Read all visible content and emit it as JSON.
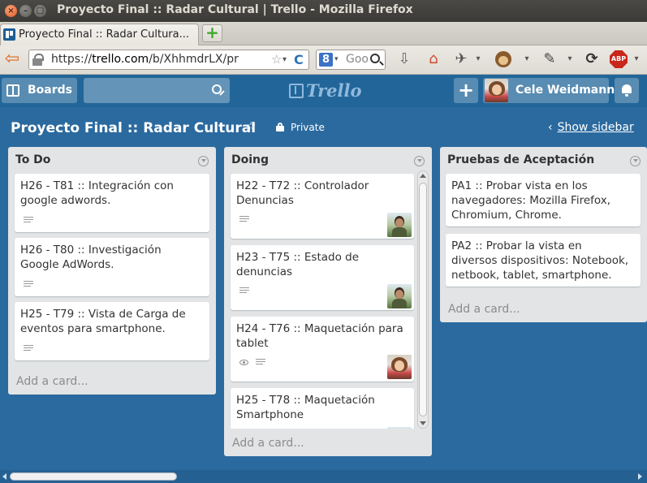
{
  "window": {
    "title": "Proyecto Final :: Radar Cultural | Trello - Mozilla Firefox",
    "close_glyph": "×",
    "min_glyph": "–",
    "max_glyph": "□"
  },
  "browser": {
    "tab_title": "Proyecto Final :: Radar Cultura...",
    "new_tab_glyph": "+",
    "url_prefix": "https://",
    "url_domain": "trello.com",
    "url_path": "/b/XhhmdrLX/pr",
    "search_engine_glyph": "8",
    "search_placeholder": "Goo",
    "back_glyph": "⇦",
    "star_glyph": "☆",
    "dropdown_glyph": "▾",
    "reload_glyph": "C",
    "download_glyph": "⇩",
    "home_glyph": "⌂",
    "ext_glyph": "✈",
    "ext2_glyph": "✎",
    "sync_glyph": "⟳",
    "abp_label": "ABP"
  },
  "header": {
    "boards_label": "Boards",
    "logo_text": "Trello",
    "add_glyph": "+",
    "user_name": "Cele Weidmann"
  },
  "board": {
    "title": "Proyecto Final :: Radar Cultural",
    "star_glyph": "☆",
    "visibility": "Private",
    "sidebar_chevron": "‹",
    "sidebar_link": "Show sidebar"
  },
  "lists": [
    {
      "name": "To Do",
      "cards": [
        {
          "title_l1": "H26 - T81 :: Integración con",
          "title_l2": "google adwords."
        },
        {
          "title_l1": "H26 - T80 :: Investigación",
          "title_l2": "Google AdWords."
        },
        {
          "title_l1": "H25 - T79 :: Vista de Carga de",
          "title_l2": "eventos para smartphone."
        }
      ],
      "add_card": "Add a card..."
    },
    {
      "name": "Doing",
      "cards": [
        {
          "title_l1": "H22 - T72 :: Controlador",
          "title_l2": "Denuncias"
        },
        {
          "title_l1": "H23 - T75 :: Estado de",
          "title_l2": "denuncias"
        },
        {
          "title_l1": "H24 - T76 :: Maquetación para",
          "title_l2": "tablet"
        },
        {
          "title_l1": "H25 - T78 :: Maquetación",
          "title_l2": "Smartphone"
        }
      ],
      "add_card": "Add a card..."
    },
    {
      "name": "Pruebas de Aceptación",
      "cards": [
        {
          "title_l1": "PA1 :: Probar vista en los",
          "title_l2": "navegadores: Mozilla Firefox,",
          "title_l3": "Chromium, Chrome."
        },
        {
          "title_l1": "PA2 :: Probar la vista en",
          "title_l2": "diversos dispositivos: Notebook,",
          "title_l3": "netbook, tablet, smartphone."
        }
      ],
      "add_card": "Add a card..."
    }
  ]
}
